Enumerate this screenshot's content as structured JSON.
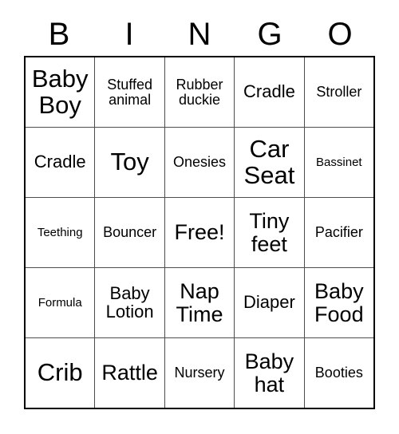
{
  "card": {
    "header": {
      "letters": [
        "B",
        "I",
        "N",
        "G",
        "O"
      ]
    },
    "grid": {
      "columns": 5,
      "rows": 5,
      "free_space": {
        "row": 2,
        "column": 2,
        "label": "Free!"
      },
      "border_color": "#000000",
      "gridline_color": "#4d4d4d",
      "cell_background": "#ffffff",
      "text_color": "#000000",
      "cells": [
        [
          {
            "label": "Baby\nBoy",
            "size": "xl"
          },
          {
            "label": "Stuffed\nanimal",
            "size": "sm"
          },
          {
            "label": "Rubber\nduckie",
            "size": "sm"
          },
          {
            "label": "Cradle",
            "size": "md"
          },
          {
            "label": "Stroller",
            "size": "sm"
          }
        ],
        [
          {
            "label": "Cradle",
            "size": "md"
          },
          {
            "label": "Toy",
            "size": "xl"
          },
          {
            "label": "Onesies",
            "size": "sm"
          },
          {
            "label": "Car\nSeat",
            "size": "xl"
          },
          {
            "label": "Bassinet",
            "size": "xs"
          }
        ],
        [
          {
            "label": "Teething",
            "size": "xs"
          },
          {
            "label": "Bouncer",
            "size": "sm"
          },
          {
            "label": "Free!",
            "size": "lg"
          },
          {
            "label": "Tiny\nfeet",
            "size": "lg"
          },
          {
            "label": "Pacifier",
            "size": "sm"
          }
        ],
        [
          {
            "label": "Formula",
            "size": "xs"
          },
          {
            "label": "Baby\nLotion",
            "size": "md"
          },
          {
            "label": "Nap\nTime",
            "size": "lg"
          },
          {
            "label": "Diaper",
            "size": "md"
          },
          {
            "label": "Baby\nFood",
            "size": "lg"
          }
        ],
        [
          {
            "label": "Crib",
            "size": "xl"
          },
          {
            "label": "Rattle",
            "size": "lg"
          },
          {
            "label": "Nursery",
            "size": "sm"
          },
          {
            "label": "Baby\nhat",
            "size": "lg"
          },
          {
            "label": "Booties",
            "size": "sm"
          }
        ]
      ]
    }
  }
}
